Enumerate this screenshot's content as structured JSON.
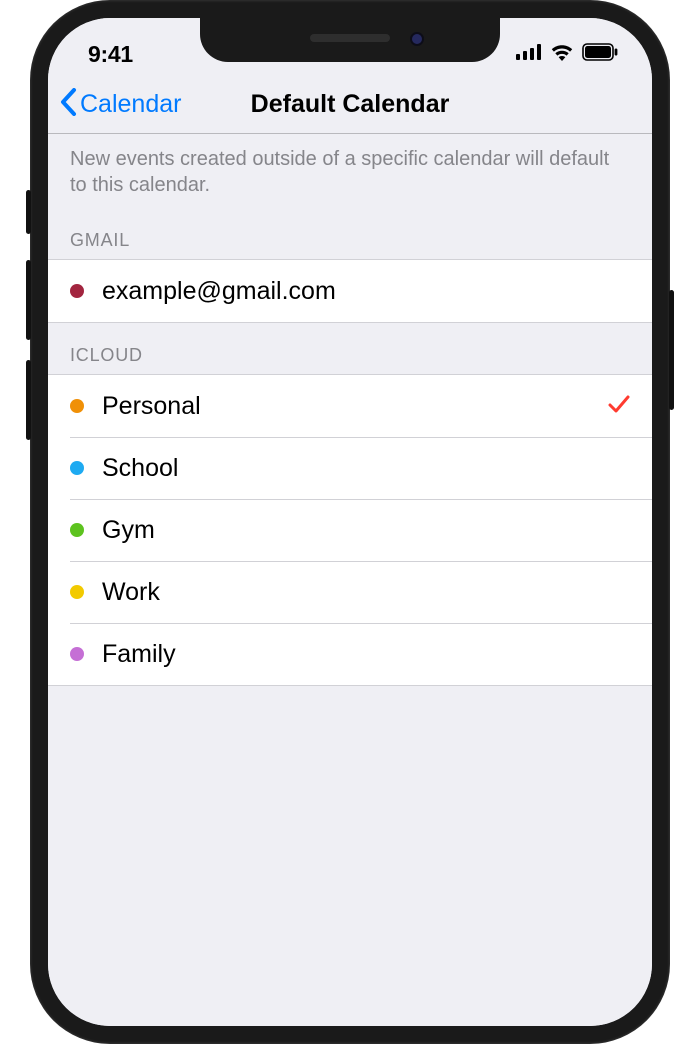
{
  "status_bar": {
    "time": "9:41"
  },
  "nav": {
    "back_label": "Calendar",
    "title": "Default Calendar"
  },
  "description": "New events created outside of a specific calendar will default to this calendar.",
  "sections": [
    {
      "header": "GMAIL",
      "items": [
        {
          "label": "example@gmail.com",
          "color": "#a2253f",
          "selected": false
        }
      ]
    },
    {
      "header": "ICLOUD",
      "items": [
        {
          "label": "Personal",
          "color": "#f09007",
          "selected": true
        },
        {
          "label": "School",
          "color": "#1eaaf1",
          "selected": false
        },
        {
          "label": "Gym",
          "color": "#5dc31f",
          "selected": false
        },
        {
          "label": "Work",
          "color": "#f2ca00",
          "selected": false
        },
        {
          "label": "Family",
          "color": "#c56fd5",
          "selected": false
        }
      ]
    }
  ],
  "colors": {
    "accent": "#007aff",
    "check": "#ff3b30"
  }
}
